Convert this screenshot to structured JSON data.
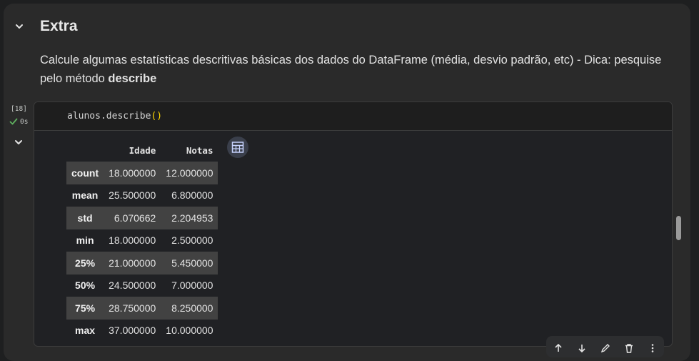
{
  "section": {
    "title": "Extra",
    "toggle_icon": "chevron-down-icon"
  },
  "text_cell": {
    "text_before": "Calcule algumas estatísticas descritivas básicas dos dados do DataFrame (média, desvio padrão, etc) - Dica: pesquise pelo método ",
    "bold_text": "describe"
  },
  "code_cell": {
    "execution_count": "[18]",
    "status_time": "0s",
    "status_icon": "check-icon",
    "code_object": "alunos.describe",
    "code_parens": "()"
  },
  "output": {
    "columns": [
      "",
      "Idade",
      "Notas"
    ],
    "rows": [
      {
        "label": "count",
        "values": [
          "18.000000",
          "12.000000"
        ]
      },
      {
        "label": "mean",
        "values": [
          "25.500000",
          "6.800000"
        ]
      },
      {
        "label": "std",
        "values": [
          "6.070662",
          "2.204953"
        ]
      },
      {
        "label": "min",
        "values": [
          "18.000000",
          "2.500000"
        ]
      },
      {
        "label": "25%",
        "values": [
          "21.000000",
          "5.450000"
        ]
      },
      {
        "label": "50%",
        "values": [
          "24.500000",
          "7.000000"
        ]
      },
      {
        "label": "75%",
        "values": [
          "28.750000",
          "8.250000"
        ]
      },
      {
        "label": "max",
        "values": [
          "37.000000",
          "10.000000"
        ]
      }
    ],
    "table_button_icon": "table-icon"
  },
  "toolbar": {
    "icons": [
      "arrow-up-icon",
      "arrow-down-icon",
      "edit-icon",
      "delete-icon",
      "more-icon"
    ]
  },
  "colors": {
    "background": "#1e1f20",
    "panel": "#2a2a2a",
    "status_ok": "#5fb05f",
    "paren": "#ffd700"
  }
}
